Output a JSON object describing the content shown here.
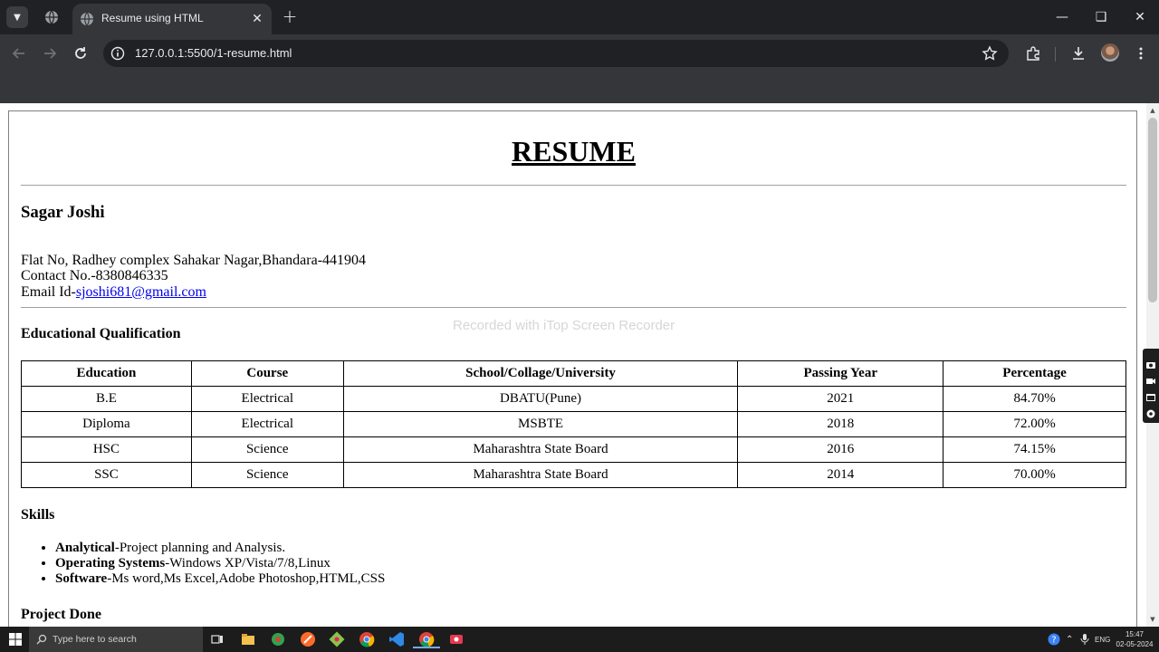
{
  "browser": {
    "tab_title": "Resume using HTML",
    "url": "127.0.0.1:5500/1-resume.html"
  },
  "resume": {
    "title": "RESUME",
    "name": "Sagar Joshi",
    "address": "Flat No, Radhey complex Sahakar Nagar,Bhandara-441904",
    "contact": "Contact No.-8380846335",
    "email_label": "Email Id-",
    "email": "sjoshi681@gmail.com",
    "edu_heading": "Educational Qualification",
    "table": {
      "headers": [
        "Education",
        "Course",
        "School/Collage/University",
        "Passing Year",
        "Percentage"
      ],
      "rows": [
        [
          "B.E",
          "Electrical",
          "DBATU(Pune)",
          "2021",
          "84.70%"
        ],
        [
          "Diploma",
          "Electrical",
          "MSBTE",
          "2018",
          "72.00%"
        ],
        [
          "HSC",
          "Science",
          "Maharashtra State Board",
          "2016",
          "74.15%"
        ],
        [
          "SSC",
          "Science",
          "Maharashtra State Board",
          "2014",
          "70.00%"
        ]
      ]
    },
    "skills_heading": "Skills",
    "skills": [
      {
        "label": "Analytical",
        "text": "-Project planning and Analysis."
      },
      {
        "label": "Operating Systems",
        "text": "-Windows XP/Vista/7/8,Linux"
      },
      {
        "label": "Software",
        "text": "-Ms word,Ms Excel,Adobe Photoshop,HTML,CSS"
      }
    ],
    "projects_heading": "Project Done"
  },
  "watermark": "Recorded with iTop Screen Recorder",
  "taskbar": {
    "search_placeholder": "Type here to search",
    "language": "ENG",
    "time": "15:47",
    "date": "02-05-2024"
  },
  "colors": {
    "chrome_dark": "#202124",
    "chrome_toolbar": "#35363a",
    "link": "#0000ee"
  }
}
